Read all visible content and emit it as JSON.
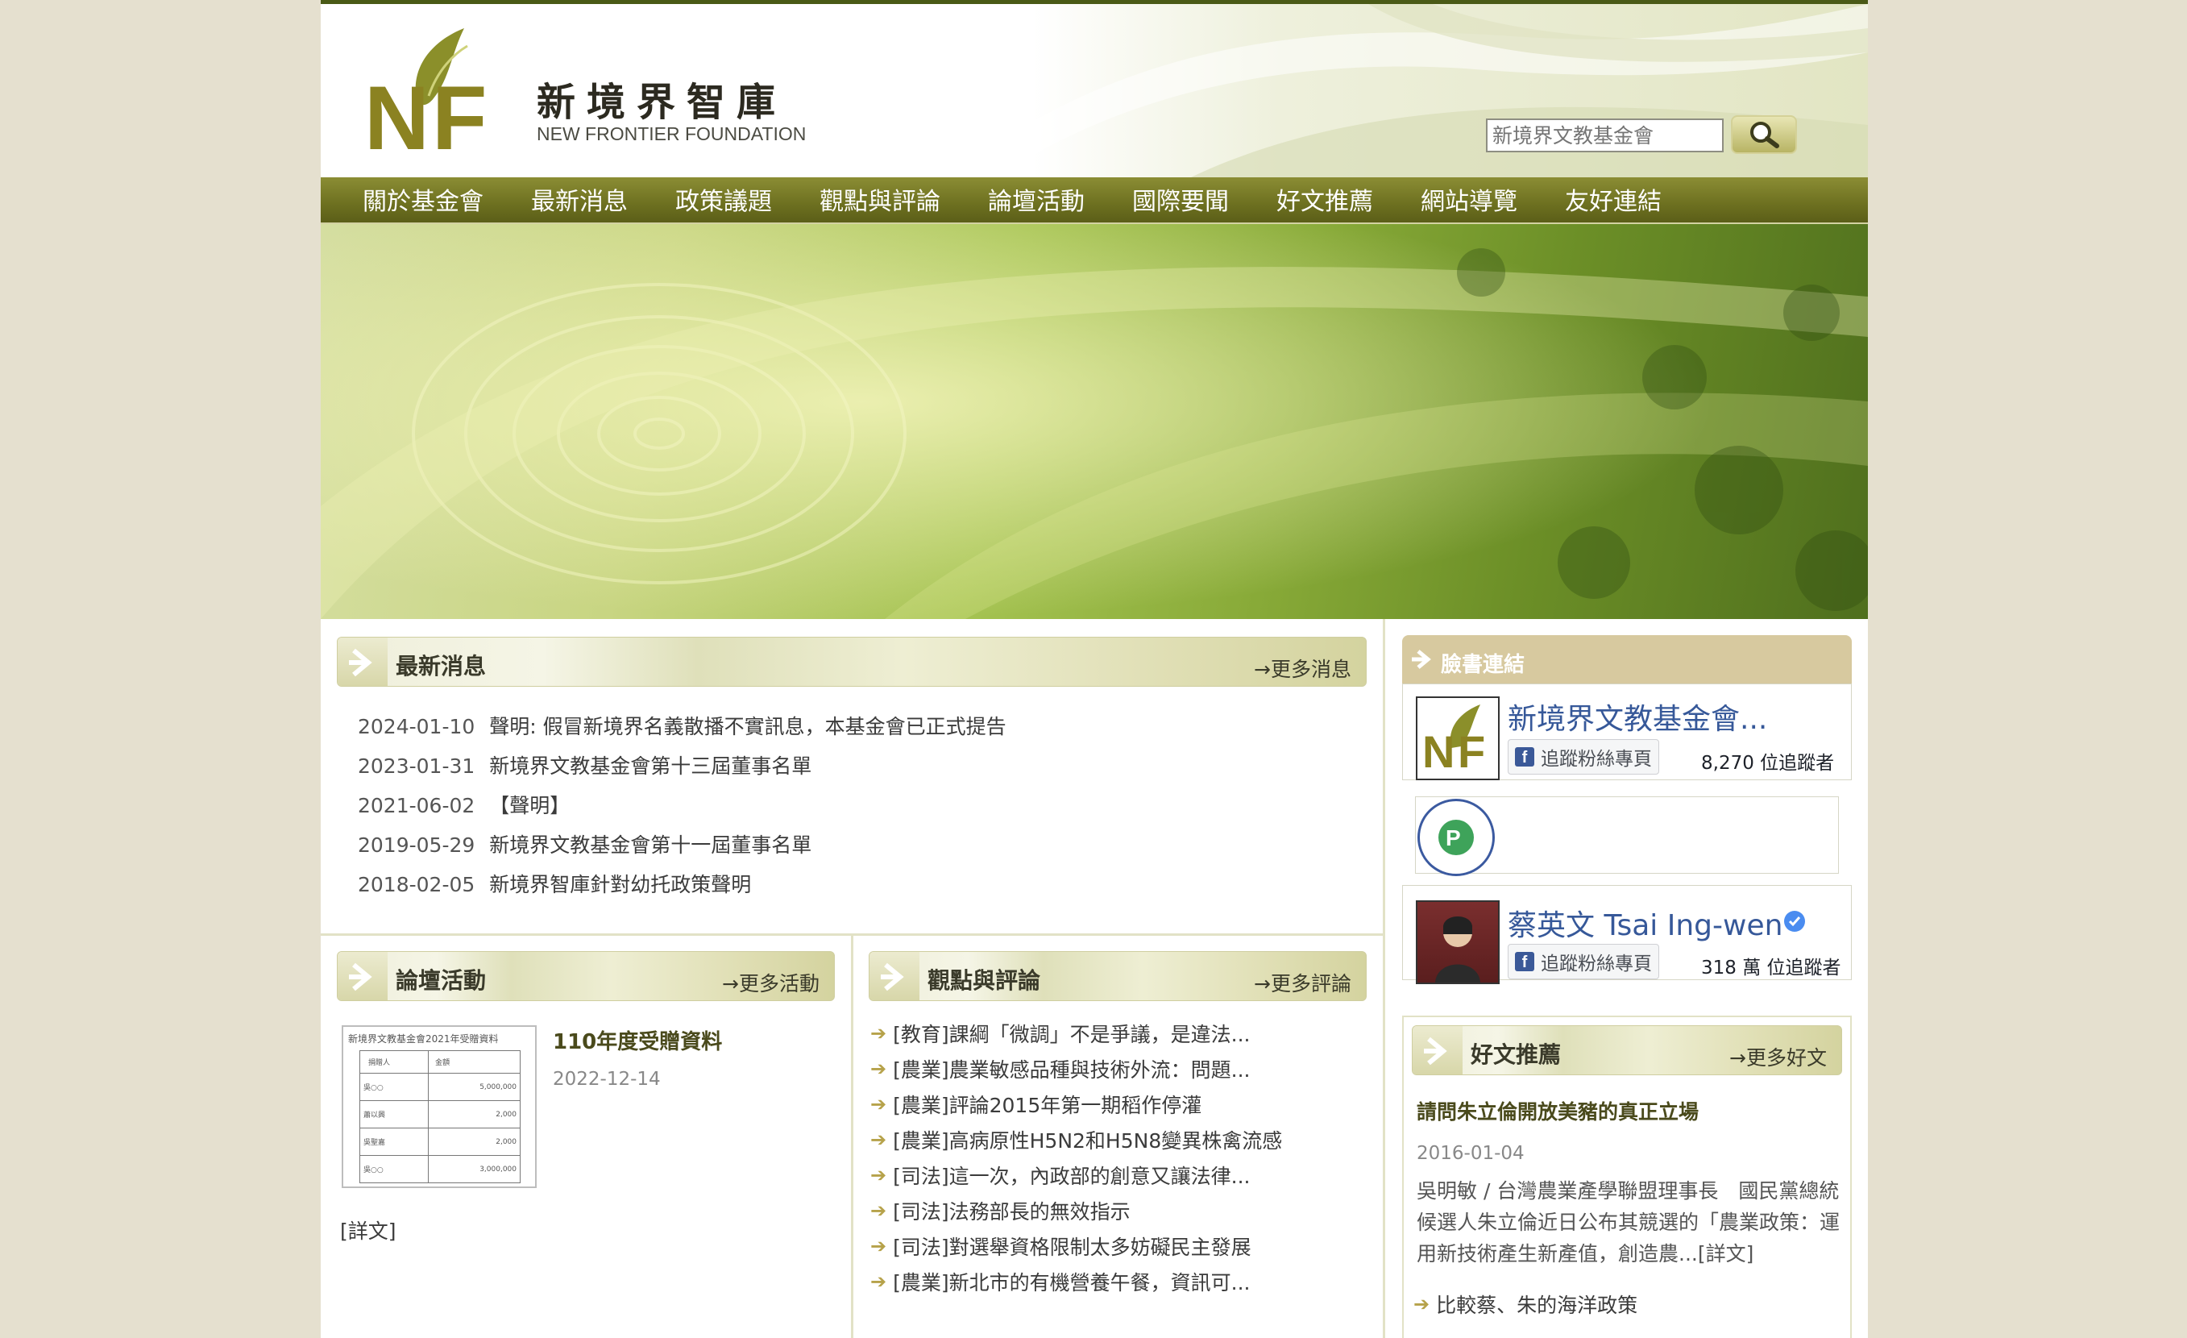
{
  "header": {
    "logo_cn": "新境界智庫",
    "logo_en": "NEW FRONTIER FOUNDATION",
    "search_placeholder": "新境界文教基金會"
  },
  "nav": [
    "關於基金會",
    "最新消息",
    "政策議題",
    "觀點與評論",
    "論壇活動",
    "國際要聞",
    "好文推薦",
    "網站導覽",
    "友好連結"
  ],
  "latest_news": {
    "title": "最新消息",
    "more": "→更多消息",
    "items": [
      {
        "date": "2024-01-10",
        "text": "聲明: 假冒新境界名義散播不實訊息，本基金會已正式提告"
      },
      {
        "date": "2023-01-31",
        "text": "新境界文教基金會第十三屆董事名單"
      },
      {
        "date": "2021-06-02",
        "text": "【聲明】"
      },
      {
        "date": "2019-05-29",
        "text": "新境界文教基金會第十一屆董事名單"
      },
      {
        "date": "2018-02-05",
        "text": "新境界智庫針對幼托政策聲明"
      }
    ]
  },
  "forum": {
    "title": "論壇活動",
    "more": "→更多活動",
    "item_title": "110年度受贈資料",
    "item_date": "2022-12-14",
    "detail": "[詳文]",
    "thumb": {
      "caption": "新境界文教基金會2021年受贈資料",
      "headers": [
        "捐贈人",
        "金額"
      ],
      "rows": [
        [
          "吳○○",
          "5,000,000"
        ],
        [
          "蕭以興",
          "2,000"
        ],
        [
          "吳聖嘉",
          "2,000"
        ],
        [
          "吳○○",
          "3,000,000"
        ]
      ]
    }
  },
  "opinion": {
    "title": "觀點與評論",
    "more": "→更多評論",
    "items": [
      "[教育]課綱「微調」不是爭議，是違法...",
      "[農業]農業敏感品種與技術外流：問題...",
      "[農業]評論2015年第一期稻作停灌",
      "[農業]高病原性H5N2和H5N8變異株禽流感",
      "[司法]這一次，內政部的創意又讓法律...",
      "[司法]法務部長的無效指示",
      "[司法]對選舉資格限制太多妨礙民主發展",
      "[農業]新北市的有機營養午餐，資訊可..."
    ]
  },
  "facebook": {
    "title": "臉書連結",
    "pages": [
      {
        "name": "新境界文教基金會...",
        "follow": "追蹤粉絲專頁",
        "count": "8,270 位追蹤者"
      },
      {
        "name": "",
        "follow": "",
        "count": ""
      },
      {
        "name": "蔡英文 Tsai Ing-wen",
        "follow": "追蹤粉絲專頁",
        "count": "318 萬 位追蹤者"
      }
    ]
  },
  "recommend": {
    "title": "好文推薦",
    "more": "→更多好文",
    "item_title": "請問朱立倫開放美豬的真正立場",
    "item_date": "2016-01-04",
    "excerpt": "吳明敏 / 台灣農業產學聯盟理事長　國民黨總統候選人朱立倫近日公布其競選的「農業政策：運用新技術產生新產值，創造農...[詳文]",
    "list": [
      "比較蔡、朱的海洋政策"
    ]
  },
  "colors": {
    "nav": "#6d7020",
    "accent": "#b6a24a",
    "fb_blue": "#3b5998",
    "page_bg": "#e5e0cf"
  }
}
